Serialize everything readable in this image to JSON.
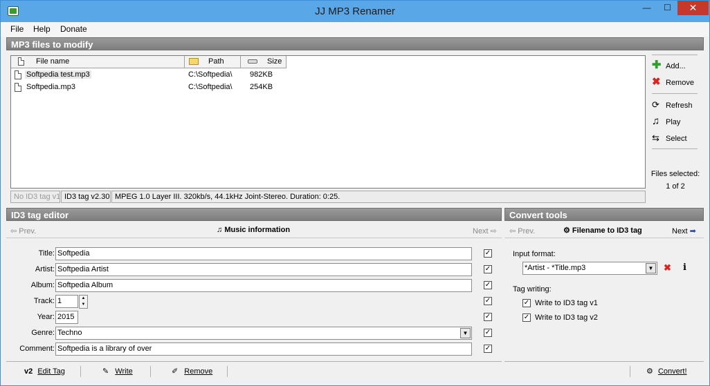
{
  "window": {
    "title": "JJ MP3 Renamer",
    "min_glyph": "—",
    "max_glyph": "☐",
    "close_glyph": "✕"
  },
  "menu": {
    "file": "File",
    "help": "Help",
    "donate": "Donate"
  },
  "files_section": {
    "title": "MP3 files to modify"
  },
  "file_list": {
    "columns": {
      "name": "File name",
      "path": "Path",
      "size": "Size"
    },
    "rows": [
      {
        "name": "Softpedia test.mp3",
        "path": "C:\\Softpedia\\",
        "size": "982KB"
      },
      {
        "name": "Softpedia.mp3",
        "path": "C:\\Softpedia\\",
        "size": "254KB"
      }
    ]
  },
  "status": {
    "tag_v1": "No ID3 tag v1",
    "tag_v2": "ID3 tag v2.30",
    "info": "MPEG 1.0 Layer III. 320kb/s, 44.1kHz Joint-Stereo. Duration: 0:25."
  },
  "side": {
    "add": "Add...",
    "remove": "Remove",
    "refresh": "Refresh",
    "play": "Play",
    "select": "Select",
    "files_selected_label": "Files selected:",
    "files_selected_value": "1 of 2"
  },
  "id3_editor": {
    "title": "ID3 tag editor",
    "prev": "Prev.",
    "next": "Next",
    "heading": "Music information",
    "fields": {
      "title_label": "Title:",
      "title_value": "Softpedia",
      "artist_label": "Artist:",
      "artist_value": "Softpedia Artist",
      "album_label": "Album:",
      "album_value": "Softpedia Album",
      "track_label": "Track:",
      "track_value": "1",
      "year_label": "Year:",
      "year_value": "2015",
      "genre_label": "Genre:",
      "genre_value": "Techno",
      "comment_label": "Comment:",
      "comment_value": "Softpedia is a library of over"
    },
    "edit_tag_badge": "v2",
    "edit_tag": "Edit Tag",
    "write": "Write",
    "remove": "Remove"
  },
  "convert": {
    "title": "Convert tools",
    "prev": "Prev.",
    "next": "Next",
    "heading": "Filename to ID3 tag",
    "input_format_label": "Input format:",
    "input_format_value": "*Artist - *Title.mp3",
    "tag_writing_label": "Tag writing:",
    "write_v1": "Write to ID3 tag v1",
    "write_v2": "Write to ID3 tag v2",
    "convert_button": "Convert!"
  },
  "colors": {
    "titlebar": "#5aa7e8",
    "section_header": "#8a8a8a",
    "close": "#c7382c"
  }
}
